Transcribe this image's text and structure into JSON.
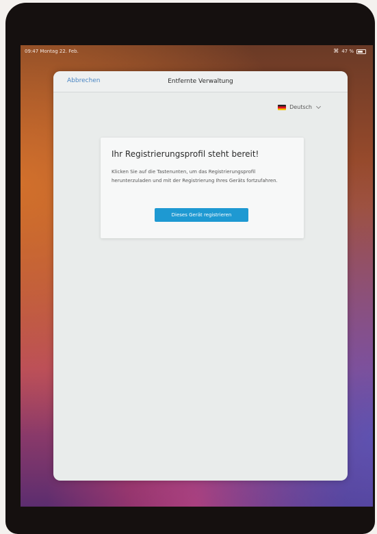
{
  "status_bar": {
    "time_date": "09:47  Montag 22. Feb.",
    "wifi_icon": "wifi-icon",
    "battery": "47 %"
  },
  "nav": {
    "cancel_label": "Abbrechen",
    "title": "Entfernte Verwaltung"
  },
  "language": {
    "flag_icon": "german-flag-icon",
    "selected": "Deutsch"
  },
  "card": {
    "title": "Ihr Registrierungsprofil steht bereit!",
    "text": "Klicken Sie auf die Tastenunten, um das Registrierungsprofil herunterzuladen und mit der Registrierung Ihres Geräts fortzufahren.",
    "button_label": "Dieses Gerät registrieren"
  },
  "colors": {
    "accent": "#1e99d2",
    "link": "#4a86c4"
  }
}
